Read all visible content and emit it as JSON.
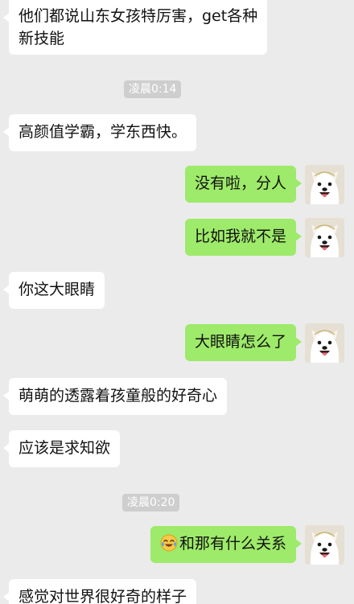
{
  "messages": [
    {
      "side": "left",
      "lines": [
        "他们都说山东女孩特厉害，get各种",
        "新技能"
      ]
    },
    {
      "side": "left",
      "text": "高颜值学霸，学东西快。"
    },
    {
      "side": "right",
      "text": "没有啦，分人"
    },
    {
      "side": "right",
      "text": "比如我就不是"
    },
    {
      "side": "left",
      "text": "你这大眼睛"
    },
    {
      "side": "right",
      "text": "大眼睛怎么了"
    },
    {
      "side": "left",
      "text": "萌萌的透露着孩童般的好奇心"
    },
    {
      "side": "left",
      "text": "应该是求知欲"
    },
    {
      "side": "right",
      "text": "和那有什么关系",
      "emoji": "laughing-crying-emoji"
    },
    {
      "side": "left",
      "text": "感觉对世界很好奇的样子"
    }
  ],
  "timestamps": [
    "凌晨0:14",
    "凌晨0:20"
  ],
  "avatar": {
    "icon": "samoyed-dog-avatar"
  },
  "colors": {
    "background": "#ebebeb",
    "sent_bubble": "#9eea6a",
    "received_bubble": "#ffffff",
    "time_badge": "#cecece"
  }
}
